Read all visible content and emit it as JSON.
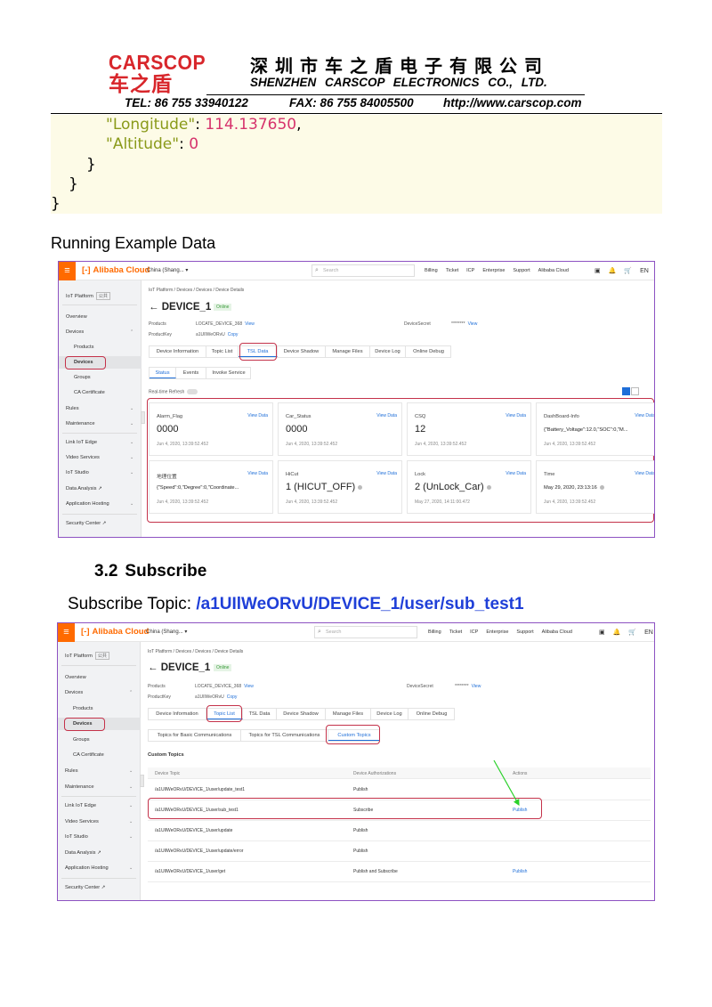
{
  "letterhead": {
    "logo_en": "CARSCOP",
    "logo_cn": "车之盾",
    "company_cn": "深圳市车之盾电子有限公司",
    "company_en": "SHENZHEN  CARSCOP  ELECTRONICS   CO.,  LTD.",
    "tel": "TEL: 86 755 33940122",
    "fax": "FAX: 86 755 84005500",
    "web": "http://www.carscop.com"
  },
  "code": {
    "line1_key": "\"Longitude\"",
    "line1_colon": ": ",
    "line1_val": "114.137650",
    "line1_end": ",",
    "line2_key": "\"Altitude\"",
    "line2_colon": ": ",
    "line2_val": "0",
    "line3": "}",
    "line4": "}",
    "line5": "}"
  },
  "running_example": "Running Example Data",
  "section": {
    "number": "3.2",
    "title": "Subscribe"
  },
  "subscribe_topic": {
    "label": "Subscribe Topic: ",
    "value": "/a1UIlWeORvU/DEVICE_1/user/sub_test1"
  },
  "console": {
    "brand": "Alibaba Cloud",
    "brand_mark": "[-]",
    "menu_icon": "≡",
    "region": "China (Shang...",
    "region_caret": "▾",
    "search_placeholder": "Search",
    "search_icon": "⌕",
    "nav": [
      "Billing",
      "Ticket",
      "ICP",
      "Enterprise",
      "Support",
      "Alibaba Cloud"
    ],
    "nav_icons": [
      "▣",
      "🔔",
      "🛒"
    ],
    "lang": "EN",
    "sidebar": {
      "title": "IoT Platform",
      "badge": "公共",
      "items": [
        "Overview",
        "Devices",
        "Products",
        "Devices",
        "Groups",
        "CA Certificate",
        "Rules",
        "Maintenance",
        "Link IoT Edge",
        "Video Services",
        "IoT Studio",
        "Data Analysis",
        "Application Hosting",
        "Security Center"
      ],
      "ext_mark": "↗",
      "chevron_down": "⌄",
      "chevron_up": "⌃"
    },
    "breadcrumb": [
      "IoT Platform",
      "/",
      "Devices",
      "/",
      "Devices",
      "/",
      "Device Details"
    ],
    "back_arrow": "←",
    "device_name": "DEVICE_1",
    "status": "Online",
    "product_label": "Products",
    "product_value": "LOCATE_DEVICE_368",
    "productkey_label": "ProductKey",
    "productkey_value": "a1UIlWeORvU",
    "secret_label": "DeviceSecret",
    "secret_value": "********",
    "view": "View",
    "copy": "Copy",
    "tabs": [
      "Device Information",
      "Topic List",
      "TSL Data",
      "Device Shadow",
      "Manage Files",
      "Device Log",
      "Online Debug"
    ]
  },
  "screenshot1": {
    "subtabs": [
      "Status",
      "Events",
      "Invoke Service"
    ],
    "realtime_label": "Real-time Refresh",
    "view_data": "View Data",
    "cards": [
      {
        "name": "Alarm_Flag",
        "value": "0000",
        "time": "Jun 4, 2020, 13:39:52.452"
      },
      {
        "name": "Car_Status",
        "value": "0000",
        "time": "Jun 4, 2020, 13:39:52.452"
      },
      {
        "name": "CSQ",
        "value": "12",
        "time": "Jun 4, 2020, 13:39:52.452"
      },
      {
        "name": "DashBoard-Info",
        "value": "{\"Battery_Voltage\":12.0,\"SOC\":0,\"M...",
        "time": "Jun 4, 2020, 13:39:52.452"
      },
      {
        "name": "地理位置",
        "value": "{\"Speed\":0,\"Degree\":0,\"Coordinate...",
        "time": "Jun 4, 2020, 13:39:52.452"
      },
      {
        "name": "HiCut",
        "value": "1 (HICUT_OFF)",
        "time": "Jun 4, 2020, 13:39:52.452"
      },
      {
        "name": "Lock",
        "value": "2 (UnLock_Car)",
        "time": "May 27, 2020, 14:11:00.472"
      },
      {
        "name": "Time",
        "value": "May 29, 2020, 23:13:16",
        "time": "Jun 4, 2020, 13:39:52.452"
      }
    ]
  },
  "screenshot2": {
    "subtabs": [
      "Topics for Basic Communications",
      "Topics for TSL Communications",
      "Custom Topics"
    ],
    "section_title": "Custom Topics",
    "columns": [
      "Device Topic",
      "Device Authorizations",
      "Actions"
    ],
    "rows": [
      {
        "topic": "/a1UIlWeORvU/DEVICE_1/user/update_test1",
        "auth": "Publish",
        "action": ""
      },
      {
        "topic": "/a1UIlWeORvU/DEVICE_1/user/sub_test1",
        "auth": "Subscribe",
        "action": "Publish"
      },
      {
        "topic": "/a1UIlWeORvU/DEVICE_1/user/update",
        "auth": "Publish",
        "action": ""
      },
      {
        "topic": "/a1UIlWeORvU/DEVICE_1/user/update/error",
        "auth": "Publish",
        "action": ""
      },
      {
        "topic": "/a1UIlWeORvU/DEVICE_1/user/get",
        "auth": "Publish and Subscribe",
        "action": "Publish"
      }
    ]
  },
  "colors": {
    "brand_red": "#d8262b",
    "alibaba_orange": "#ff6a00",
    "highlight_red": "#c4324a",
    "link_blue": "#1e6ed8",
    "topic_blue": "#1f3fd8",
    "arrow_green": "#2bd12b"
  }
}
